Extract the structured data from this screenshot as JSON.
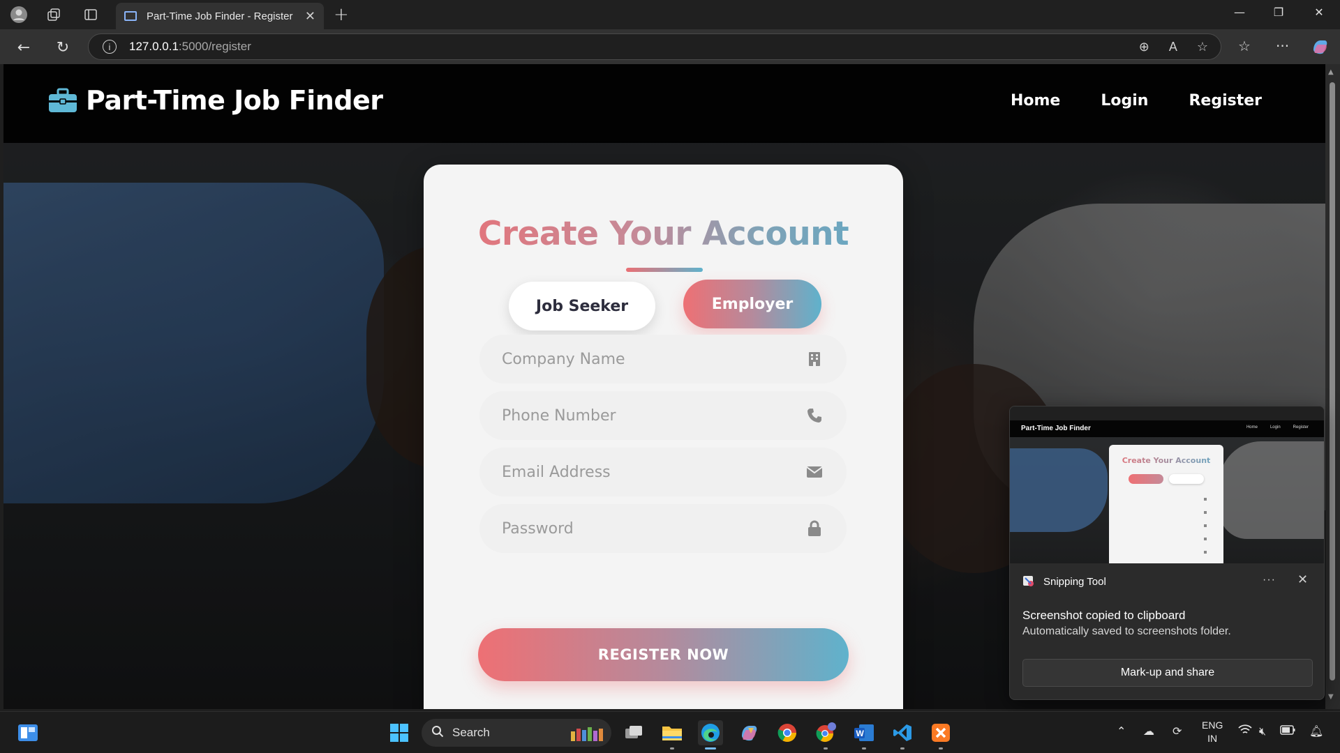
{
  "browser": {
    "tab_title": "Part-Time Job Finder - Register",
    "url_host": "127.0.0.1",
    "url_path": ":5000/register"
  },
  "site": {
    "brand": "Part-Time Job Finder",
    "nav": {
      "home": "Home",
      "login": "Login",
      "register": "Register"
    }
  },
  "form": {
    "title": "Create Your Account",
    "roles": {
      "seeker": "Job Seeker",
      "employer": "Employer",
      "selected": "Employer"
    },
    "fields": {
      "company": {
        "placeholder": "Company Name",
        "icon": "building-icon"
      },
      "phone": {
        "placeholder": "Phone Number",
        "icon": "phone-icon"
      },
      "email": {
        "placeholder": "Email Address",
        "icon": "envelope-icon"
      },
      "password": {
        "placeholder": "Password",
        "icon": "lock-icon"
      }
    },
    "submit": "REGISTER NOW"
  },
  "toast": {
    "app": "Snipping Tool",
    "heading": "Screenshot copied to clipboard",
    "sub": "Automatically saved to screenshots folder.",
    "button": "Mark-up and share",
    "more": "···",
    "close": "✕",
    "preview": {
      "brand": "Part-Time Job Finder",
      "title": "Create Your Account",
      "links": [
        "Home",
        "Login",
        "Register"
      ]
    }
  },
  "taskbar": {
    "search": "Search",
    "lang_line1": "ENG",
    "lang_line2": "IN"
  },
  "colors": {
    "accent_red": "#ee7074",
    "accent_blue": "#5fb2cc",
    "nav_bg": "#000000",
    "card_bg": "#f4f4f4"
  }
}
